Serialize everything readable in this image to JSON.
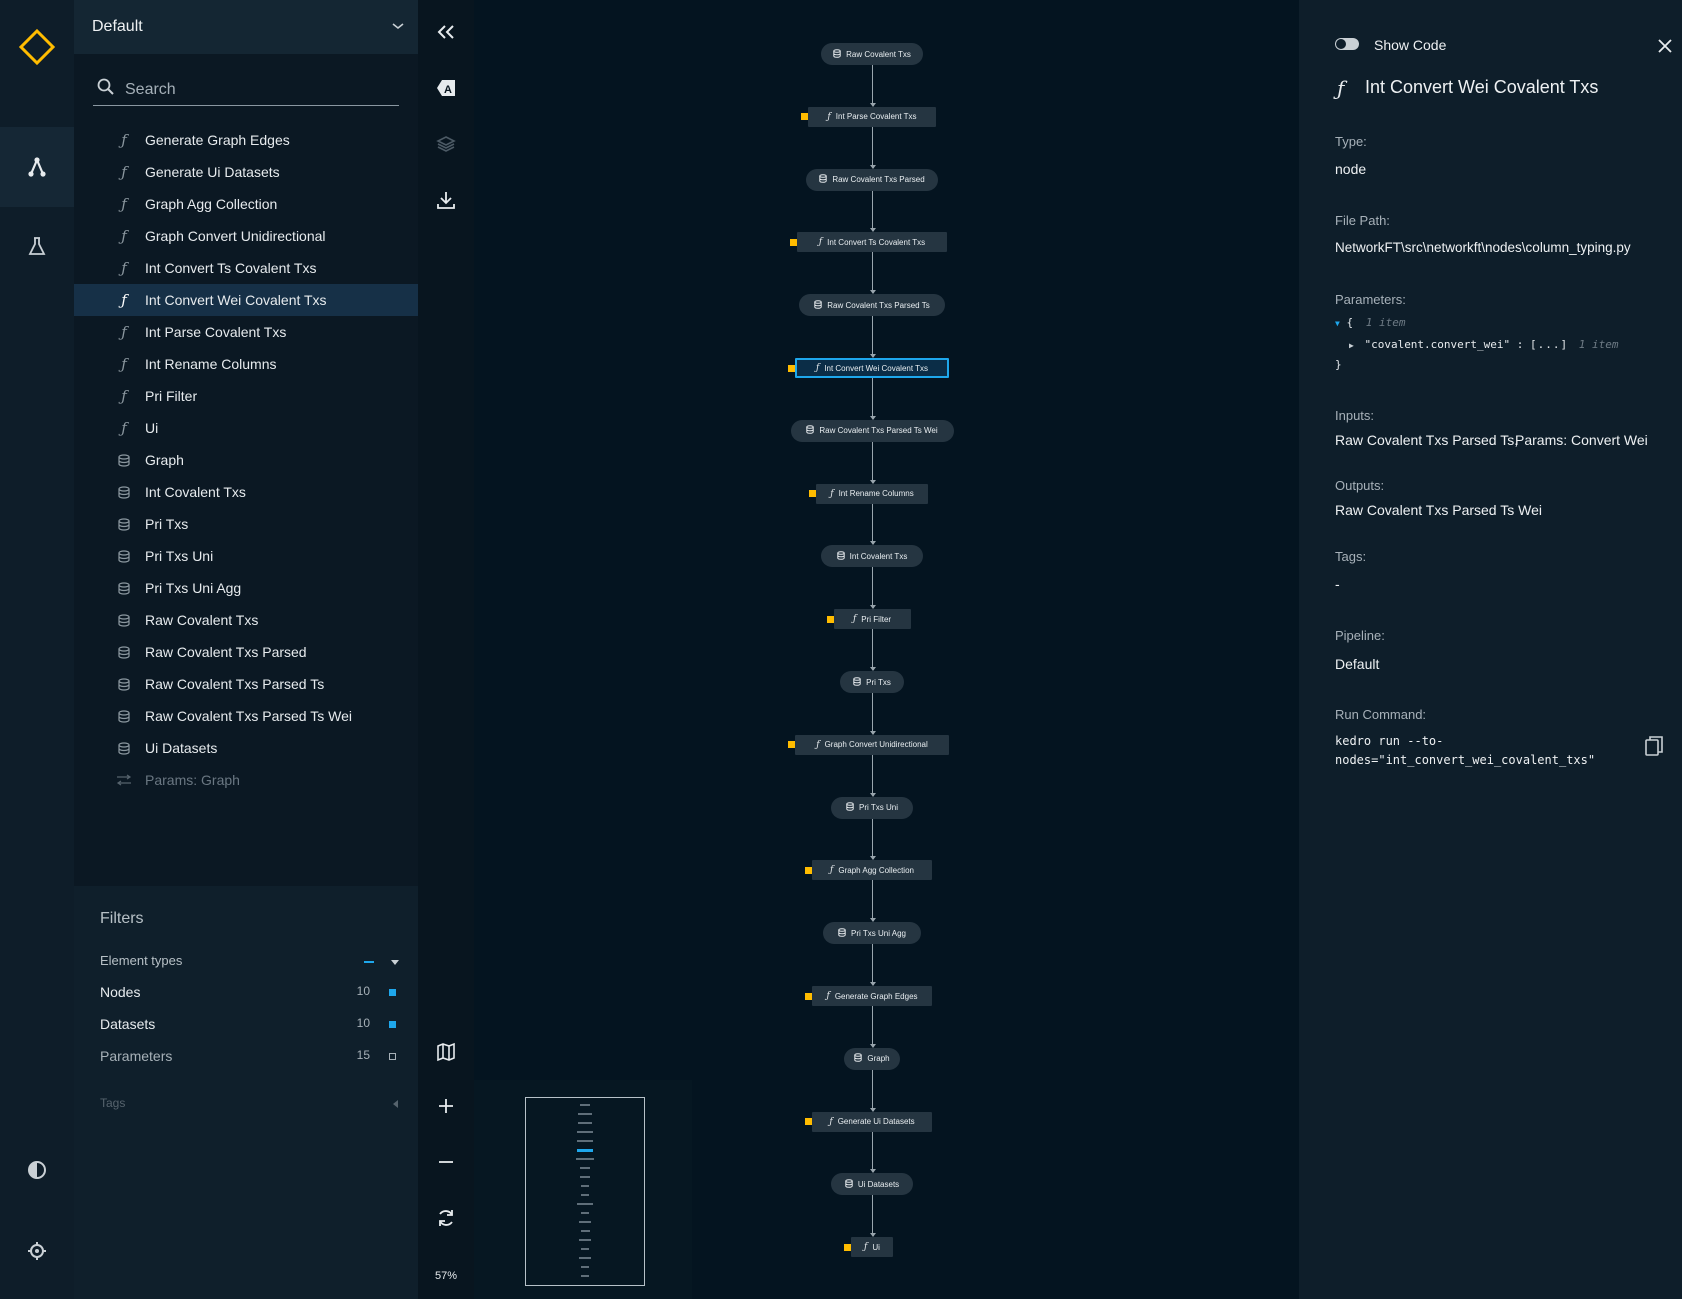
{
  "app": {
    "name": "Kedro-Viz"
  },
  "sidebar": {
    "pipeline": "Default",
    "search_placeholder": "Search",
    "items": [
      {
        "label": "Generate Graph Edges",
        "kind": "function"
      },
      {
        "label": "Generate Ui Datasets",
        "kind": "function"
      },
      {
        "label": "Graph Agg Collection",
        "kind": "function"
      },
      {
        "label": "Graph Convert Unidirectional",
        "kind": "function"
      },
      {
        "label": "Int Convert Ts Covalent Txs",
        "kind": "function"
      },
      {
        "label": "Int Convert Wei Covalent Txs",
        "kind": "function",
        "selected": true
      },
      {
        "label": "Int Parse Covalent Txs",
        "kind": "function"
      },
      {
        "label": "Int Rename Columns",
        "kind": "function"
      },
      {
        "label": "Pri Filter",
        "kind": "function"
      },
      {
        "label": "Ui",
        "kind": "function"
      },
      {
        "label": "Graph",
        "kind": "dataset"
      },
      {
        "label": "Int Covalent Txs",
        "kind": "dataset"
      },
      {
        "label": "Pri Txs",
        "kind": "dataset"
      },
      {
        "label": "Pri Txs Uni",
        "kind": "dataset"
      },
      {
        "label": "Pri Txs Uni Agg",
        "kind": "dataset"
      },
      {
        "label": "Raw Covalent Txs",
        "kind": "dataset"
      },
      {
        "label": "Raw Covalent Txs Parsed",
        "kind": "dataset"
      },
      {
        "label": "Raw Covalent Txs Parsed Ts",
        "kind": "dataset"
      },
      {
        "label": "Raw Covalent Txs Parsed Ts Wei",
        "kind": "dataset"
      },
      {
        "label": "Ui Datasets",
        "kind": "dataset"
      },
      {
        "label": "Params: Graph",
        "kind": "parameter",
        "faded": true
      }
    ],
    "filters": {
      "title": "Filters",
      "element_types_label": "Element types",
      "rows": [
        {
          "label": "Nodes",
          "count": "10",
          "active": true
        },
        {
          "label": "Datasets",
          "count": "10",
          "active": true
        },
        {
          "label": "Parameters",
          "count": "15",
          "active": false
        }
      ],
      "tags_label": "Tags"
    }
  },
  "toolbar": {
    "zoom": "57%"
  },
  "graph": {
    "nodes": [
      {
        "label": "Raw Covalent Txs",
        "kind": "dataset"
      },
      {
        "label": "Int Parse Covalent Txs",
        "kind": "function",
        "param": true
      },
      {
        "label": "Raw Covalent Txs Parsed",
        "kind": "dataset"
      },
      {
        "label": "Int Convert Ts Covalent Txs",
        "kind": "function",
        "param": true
      },
      {
        "label": "Raw Covalent Txs Parsed Ts",
        "kind": "dataset"
      },
      {
        "label": "Int Convert Wei Covalent Txs",
        "kind": "function",
        "param": true,
        "selected": true
      },
      {
        "label": "Raw Covalent Txs Parsed Ts Wei",
        "kind": "dataset"
      },
      {
        "label": "Int Rename Columns",
        "kind": "function",
        "param": true
      },
      {
        "label": "Int Covalent Txs",
        "kind": "dataset"
      },
      {
        "label": "Pri Filter",
        "kind": "function",
        "param": true
      },
      {
        "label": "Pri Txs",
        "kind": "dataset"
      },
      {
        "label": "Graph Convert Unidirectional",
        "kind": "function",
        "param": true
      },
      {
        "label": "Pri Txs Uni",
        "kind": "dataset"
      },
      {
        "label": "Graph Agg Collection",
        "kind": "function",
        "param": true
      },
      {
        "label": "Pri Txs Uni Agg",
        "kind": "dataset"
      },
      {
        "label": "Generate Graph Edges",
        "kind": "function",
        "param": true
      },
      {
        "label": "Graph",
        "kind": "dataset"
      },
      {
        "label": "Generate Ui Datasets",
        "kind": "function",
        "param": true
      },
      {
        "label": "Ui Datasets",
        "kind": "dataset"
      },
      {
        "label": "Ui",
        "kind": "function",
        "param": true
      }
    ]
  },
  "panel": {
    "show_code_label": "Show Code",
    "title": "Int Convert Wei Covalent Txs",
    "type_label": "Type:",
    "type_value": "node",
    "filepath_label": "File Path:",
    "filepath_value": "NetworkFT\\src\\networkft\\nodes\\column_typing.py",
    "parameters_label": "Parameters:",
    "parameters_open": "{",
    "parameters_count": "1 item",
    "parameters_key": "\"covalent.convert_wei\"",
    "parameters_colon": ":",
    "parameters_value": "[...]",
    "parameters_value_count": "1 item",
    "parameters_close": "}",
    "inputs_label": "Inputs:",
    "inputs_value_1": "Raw Covalent Txs Parsed Ts,",
    "inputs_value_2": "Params: Convert Wei",
    "outputs_label": "Outputs:",
    "outputs_value": "Raw Covalent Txs Parsed Ts Wei",
    "tags_label": "Tags:",
    "tags_value": "-",
    "pipeline_label": "Pipeline:",
    "pipeline_value": "Default",
    "run_label": "Run Command:",
    "run_line_1": "kedro run --to-",
    "run_line_2": "nodes=\"int_convert_wei_covalent_txs\""
  },
  "colors": {
    "accent": "#1ea7ec",
    "param": "#ffbc00",
    "logo": "#ffbc00"
  }
}
